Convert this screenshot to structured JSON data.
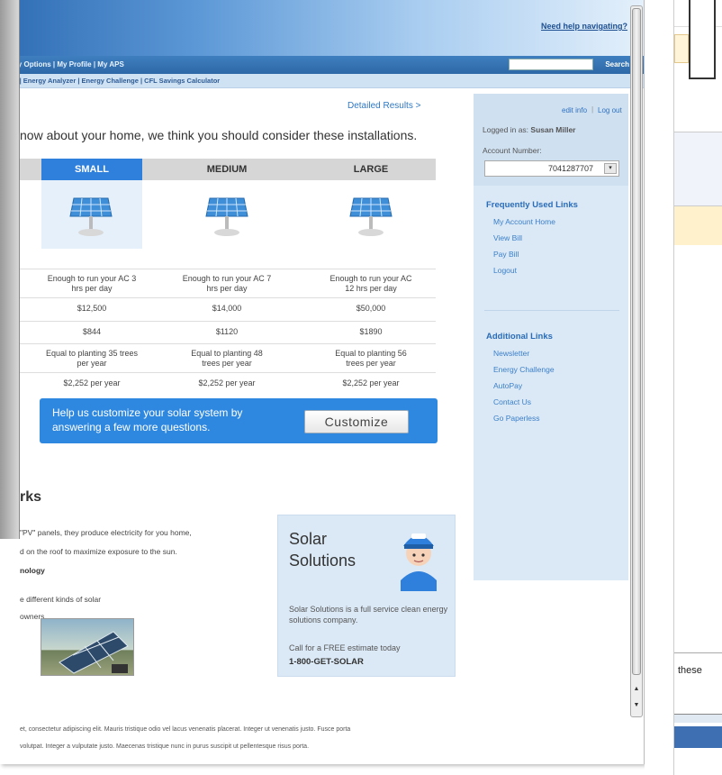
{
  "header": {
    "help_link": "Need help navigating?",
    "nav_primary": "y | My Options | My Profile | My APS",
    "nav_secondary": "Save | Energy Analyzer | Energy Challenge | CFL Savings Calculator",
    "search_label": "Search"
  },
  "main": {
    "detailed_link": "Detailed Results >",
    "headline": "now about your home, we think you should consider these installations.",
    "columns": [
      {
        "label": "SMALL",
        "selected": true
      },
      {
        "label": "MEDIUM",
        "selected": false
      },
      {
        "label": "LARGE",
        "selected": false
      }
    ],
    "rows": {
      "capacity": [
        "Enough to run your AC 3 hrs per day",
        "Enough to run your AC 7 hrs per day",
        "Enough to run your AC 12 hrs per day"
      ],
      "cost": [
        "$12,500",
        "$14,000",
        "$50,000"
      ],
      "savings": [
        "$844",
        "$1120",
        "$1890"
      ],
      "trees": [
        "Equal to planting 35 trees per year",
        "Equal to planting 48 trees per year",
        "Equal to planting 56 trees per year"
      ],
      "per_year": [
        "$2,252 per year",
        "$2,252 per year",
        "$2,252 per year"
      ]
    },
    "cta_text": "Help us customize your solar system by answering a few more questions.",
    "cta_button": "Customize"
  },
  "sidebar": {
    "edit_info": "edit info",
    "log_out": "Log out",
    "logged_in_prefix": "Logged in as: ",
    "user_name": "Susan Miller",
    "account_label": "Account Number:",
    "account_number": "7041287707",
    "frequent_heading": "Frequently Used Links",
    "frequent_links": [
      "My Account Home",
      "View Bill",
      "Pay Bill",
      "Logout"
    ],
    "additional_heading": "Additional Links",
    "additional_links": [
      "Newsletter",
      "Energy Challenge",
      "AutoPay",
      "Contact Us",
      "Go Paperless"
    ]
  },
  "how_it_works": {
    "heading": "rks",
    "line1": "\"PV\" panels, they produce electricity for you home,",
    "line2": "d on the roof to maximize exposure to the sun.",
    "tech_heading": "nology",
    "tech_line1": "e different kinds of solar",
    "tech_line2": "owners."
  },
  "solar_box": {
    "title": "Solar Solutions",
    "desc": "Solar Solutions is a full service clean energy solutions company.",
    "call": "Call for a FREE estimate today",
    "phone": "1-800-GET-SOLAR"
  },
  "footer": {
    "lorem1": "et, consectetur adipiscing elit. Mauris tristique odio vel lacus venenatis placerat. Integer ut venenatis justo. Fusce porta",
    "lorem2": "volutpat. Integer a vulputate justo. Maecenas tristique nunc in purus suscipit ut pellentesque risus porta."
  },
  "background_app": {
    "text": "these"
  },
  "colors": {
    "accent_blue": "#2f7fdc",
    "sidebar_bg": "#dbe9f6",
    "link_blue": "#2f72c0"
  },
  "icons": [
    "solar-panel-icon",
    "technician-icon",
    "dropdown-arrow-icon"
  ]
}
